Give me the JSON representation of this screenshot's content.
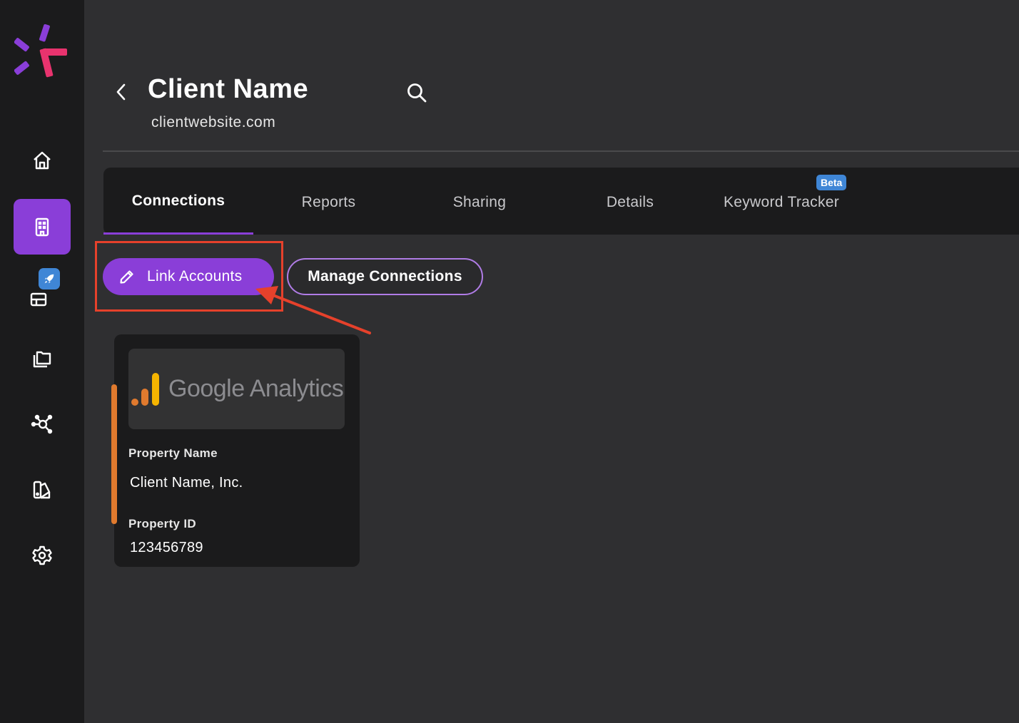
{
  "sidebar": {
    "items": [
      {
        "icon": "home-icon"
      },
      {
        "icon": "building-icon",
        "active": true
      },
      {
        "icon": "rocket-icon"
      },
      {
        "icon": "folders-icon"
      },
      {
        "icon": "network-icon"
      },
      {
        "icon": "palette-icon"
      },
      {
        "icon": "gear-icon"
      }
    ]
  },
  "header": {
    "title": "Client Name",
    "website": "clientwebsite.com"
  },
  "tabs": {
    "connections": "Connections",
    "reports": "Reports",
    "sharing": "Sharing",
    "details": "Details",
    "keyword_tracker": "Keyword Tracker",
    "beta_badge": "Beta",
    "active": "Connections"
  },
  "actions": {
    "link_accounts": "Link Accounts",
    "manage_connections": "Manage Connections"
  },
  "connection_card": {
    "provider_logo_text": "Google Analytics",
    "property_name_label": "Property Name",
    "property_name": "Client Name, Inc.",
    "property_id_label": "Property ID",
    "property_id": "123456789",
    "accent_color": "#e07a2e"
  },
  "colors": {
    "accent": "#8a3ed8",
    "badge": "#3f86d6",
    "annotation": "#e6412b"
  }
}
